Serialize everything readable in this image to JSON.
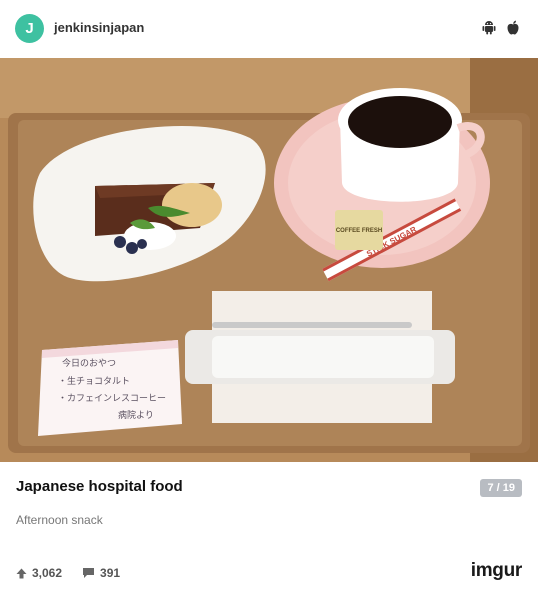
{
  "header": {
    "avatar_letter": "J",
    "username": "jenkinsinjapan",
    "icons": [
      "android-icon",
      "apple-icon"
    ]
  },
  "post": {
    "title": "Japanese hospital food",
    "counter": "7 / 19",
    "description": "Afternoon snack"
  },
  "stats": {
    "points": "3,062",
    "comments": "391"
  },
  "brand": {
    "logo_text": "imgur",
    "accent": "#1bb76e"
  },
  "photo": {
    "card_lines": [
      "今日のおやつ",
      "・生チョコタルト",
      "・カフェインレスコーヒー",
      "病院より"
    ],
    "sugar_label": "STICK SUGAR",
    "creamer_label": "COFFEE FRESH"
  },
  "colors": {
    "avatar": "#3ec1a1",
    "counter_bg": "#b8bcc2",
    "tray": "#a47a4e",
    "table": "#b78a5a"
  }
}
